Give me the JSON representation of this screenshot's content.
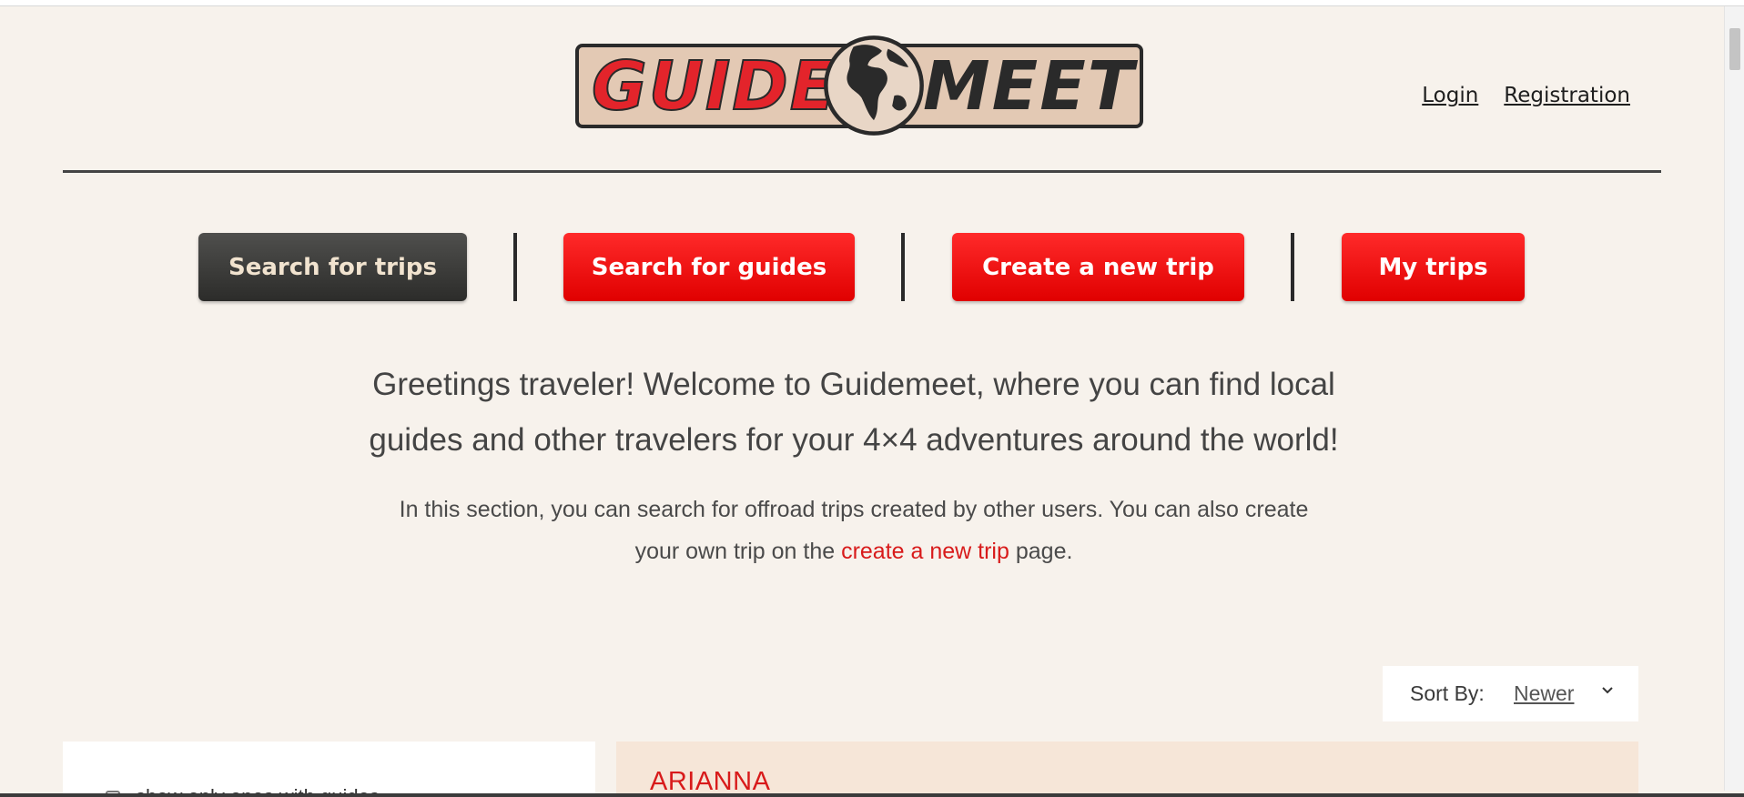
{
  "header": {
    "logo_left": "GUIDE",
    "logo_right": "MEET",
    "login_label": "Login",
    "registration_label": "Registration"
  },
  "nav": {
    "items": [
      {
        "label": "Search for trips",
        "active": true
      },
      {
        "label": "Search for guides",
        "active": false
      },
      {
        "label": "Create a new trip",
        "active": false
      },
      {
        "label": "My trips",
        "active": false
      }
    ]
  },
  "intro": {
    "title_line1": "Greetings traveler! Welcome to Guidemeet, where you can find local",
    "title_line2": "guides and other travelers for your 4×4 adventures around the world!",
    "text_line1": "In this section, you can search for offroad trips created by other users. You can also create",
    "text_prefix": "your own trip on the ",
    "text_link": "create a new trip",
    "text_suffix": " page."
  },
  "sort": {
    "label": "Sort By:",
    "value": "Newer"
  },
  "filters": {
    "first_label": "show only ones with guides"
  },
  "trips": [
    {
      "name": "ARIANNA"
    }
  ],
  "colors": {
    "background": "#f7f2ec",
    "accent_red": "#e00000",
    "active_dark": "#2c2c2a",
    "link_red": "#d81b1b",
    "card_bg": "#f6e6d8"
  }
}
